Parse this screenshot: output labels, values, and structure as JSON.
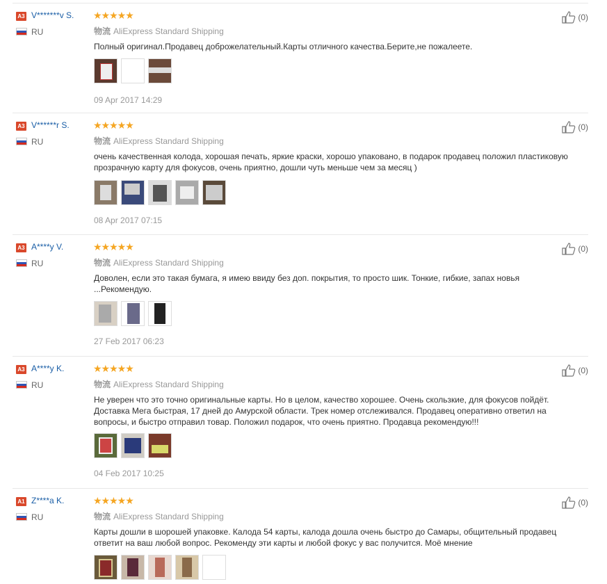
{
  "shipping_cn": "物流",
  "reviews": [
    {
      "badge": "A3",
      "user": "V*******v S.",
      "country": "RU",
      "stars": "★★★★★",
      "shipping": "AliExpress Standard Shipping",
      "text": "Полный оригинал.Продавец доброжелательный.Карты отличного качества.Берите,не пожалеете.",
      "date": "09 Apr 2017 14:29",
      "likes": "(0)"
    },
    {
      "badge": "A3",
      "user": "V******r S.",
      "country": "RU",
      "stars": "★★★★★",
      "shipping": "AliExpress Standard Shipping",
      "text": "очень качественная колода, хорошая печать, яркие краски, хорошо упаковано, в подарок продавец положил пластиковую прозрачную карту для фокусов, очень приятно, дошли чуть меньше чем за месяц )",
      "date": "08 Apr 2017 07:15",
      "likes": "(0)"
    },
    {
      "badge": "A3",
      "user": "A****y V.",
      "country": "RU",
      "stars": "★★★★★",
      "shipping": "AliExpress Standard Shipping",
      "text": "Доволен, если это такая бумага, я имею ввиду без доп. покрытия, то просто шик. Тонкие, гибкие, запах новья ...Рекомендую.",
      "date": "27 Feb 2017 06:23",
      "likes": "(0)"
    },
    {
      "badge": "A3",
      "user": "A****y K.",
      "country": "RU",
      "stars": "★★★★★",
      "shipping": "AliExpress Standard Shipping",
      "text": "Не уверен что это точно оригинальные карты. Но в целом, качество хорошее. Очень скользкие, для фокусов пойдёт. Доставка Мега быстрая, 17 дней до Амурской области. Трек номер отслеживался. Продавец оперативно ответил на вопросы, и быстро отправил товар. Положил подарок, что очень приятно. Продавца рекомендую!!!",
      "date": "04 Feb 2017 10:25",
      "likes": "(0)"
    },
    {
      "badge": "A1",
      "user": "Z****a K.",
      "country": "RU",
      "stars": "★★★★★",
      "shipping": "AliExpress Standard Shipping",
      "text": "Карты дошли в шорошей упаковке. Калода 54 карты, калода дошла очень быстро до Самары, общительный продавец ответит на ваш любой вопрос. Рекоменду эти карты и любой фокус у вас получится. Моё мнение",
      "date": "",
      "likes": "(0)"
    }
  ],
  "colors": {
    "accent": "#1a5ea6",
    "star": "#f5a623",
    "badge": "#d9482b"
  }
}
